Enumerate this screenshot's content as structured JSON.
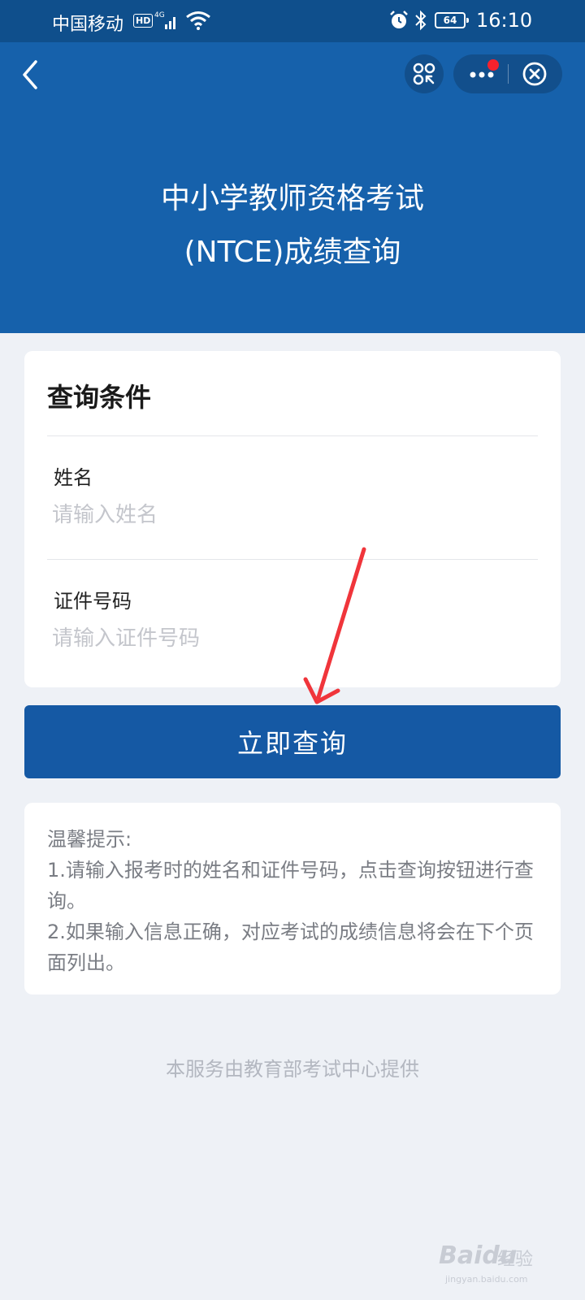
{
  "status_bar": {
    "carrier": "中国移动",
    "hd": "HD",
    "network": "4G",
    "battery": "64",
    "time": "16:10"
  },
  "header": {
    "title_line1": "中小学教师资格考试",
    "title_line2": "(NTCE)成绩查询"
  },
  "form": {
    "section_title": "查询条件",
    "name_label": "姓名",
    "name_placeholder": "请输入姓名",
    "id_label": "证件号码",
    "id_placeholder": "请输入证件号码",
    "submit_label": "立即查询"
  },
  "tips": {
    "heading": "温馨提示:",
    "line1": "1.请输入报考时的姓名和证件号码，点击查询按钮进行查询。",
    "line2": "2.如果输入信息正确，对应考试的成绩信息将会在下个页面列出。"
  },
  "footer": {
    "provider": "本服务由教育部考试中心提供"
  },
  "watermark": {
    "brand": "Baidu",
    "sub": "经验",
    "url": "jingyan.baidu.com"
  },
  "colors": {
    "header_bg": "#1661ab",
    "status_bg": "#0f4f8c",
    "primary_button": "#1559a4",
    "page_bg": "#eef1f6",
    "annotation_arrow": "#f0353b"
  }
}
